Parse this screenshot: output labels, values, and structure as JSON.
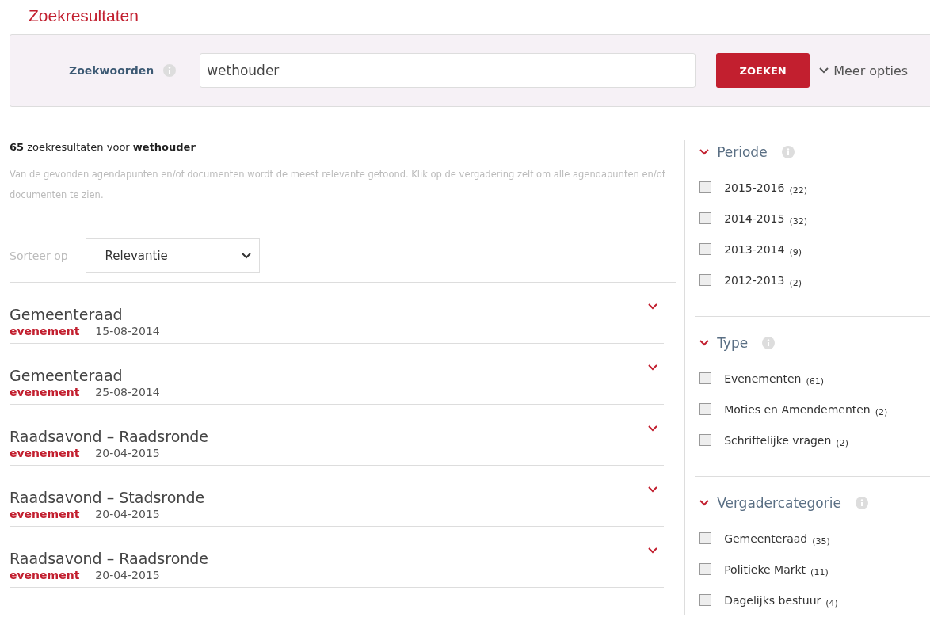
{
  "page_title": "Zoekresultaten",
  "search": {
    "label": "Zoekwoorden",
    "value": "wethouder",
    "button": "ZOEKEN",
    "more_options": "Meer opties"
  },
  "summary": "**65** zoekresultaten voor **wethouder**",
  "description": "Van de gevonden agendapunten en/of documenten wordt de meest relevante getoond. Klik op de vergadering zelf om alle agendapunten en/of documenten te zien.",
  "sort": {
    "label": "Sorteer op",
    "value": "Relevantie"
  },
  "results": [
    {
      "title": "Gemeenteraad",
      "type": "evenement",
      "date": "15-08-2014"
    },
    {
      "title": "Gemeenteraad",
      "type": "evenement",
      "date": "25-08-2014"
    },
    {
      "title": "Raadsavond – Raadsronde",
      "type": "evenement",
      "date": "20-04-2015"
    },
    {
      "title": "Raadsavond – Stadsronde",
      "type": "evenement",
      "date": "20-04-2015"
    },
    {
      "title": "Raadsavond – Raadsronde",
      "type": "evenement",
      "date": "20-04-2015"
    }
  ],
  "filters": [
    {
      "title": "Periode",
      "expanded": true,
      "options": [
        {
          "label": "2015-2016",
          "count": "(22)",
          "checked": false
        },
        {
          "label": "2014-2015",
          "count": "(32)",
          "checked": false
        },
        {
          "label": "2013-2014",
          "count": "(9)",
          "checked": false
        },
        {
          "label": "2012-2013",
          "count": "(2)",
          "checked": false
        }
      ]
    },
    {
      "title": "Type",
      "expanded": true,
      "options": [
        {
          "label": "Evenementen",
          "count": "(61)",
          "checked": false
        },
        {
          "label": "Moties en Amendementen",
          "count": "(2)",
          "checked": false
        },
        {
          "label": "Schriftelijke vragen",
          "count": "(2)",
          "checked": false
        }
      ]
    },
    {
      "title": "Vergadercategorie",
      "expanded": true,
      "options": [
        {
          "label": "Gemeenteraad",
          "count": "(35)",
          "checked": false
        },
        {
          "label": "Politieke Markt",
          "count": "(11)",
          "checked": false
        },
        {
          "label": "Dagelijks bestuur",
          "count": "(4)",
          "checked": false
        }
      ]
    }
  ]
}
